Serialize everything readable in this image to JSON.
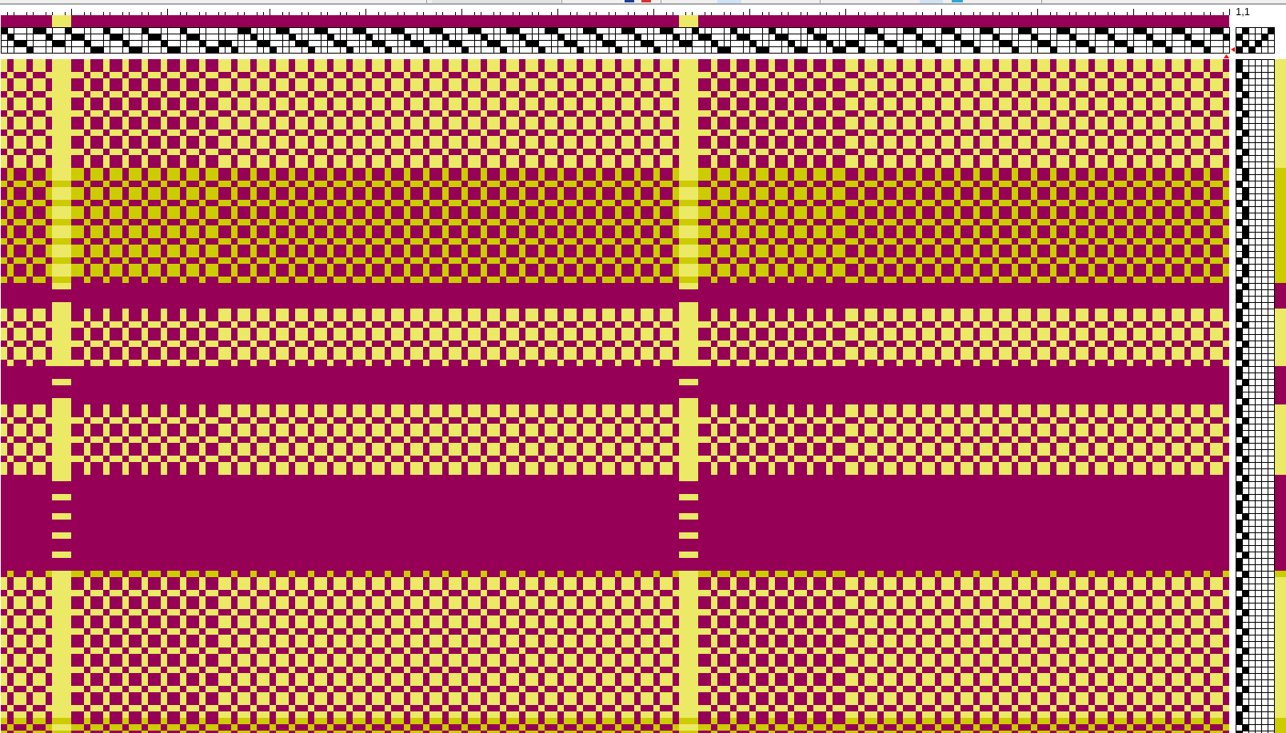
{
  "position_label": "1,1",
  "warp_stripes": [
    {
      "color": "#960056",
      "ends": [
        {
          "kind": "shaft4"
        },
        {
          "kind": "shaft3"
        },
        {
          "kind": "shaft2"
        },
        {
          "kind": "shaft2"
        },
        {
          "kind": "shaft1"
        },
        {
          "kind": "shaft4"
        },
        {
          "kind": "shaft4"
        },
        {
          "kind": "shaft3"
        }
      ]
    },
    {
      "color": "#ece966",
      "ends": [
        {
          "kind": "shaft2"
        },
        {
          "kind": "shaft2"
        },
        {
          "kind": "shaft4"
        }
      ]
    },
    {
      "color": "#960056",
      "ends": [
        {
          "kind": "shaft3"
        },
        {
          "kind": "shaft3"
        },
        {
          "kind": "shaft2"
        },
        {
          "kind": "shaft1"
        },
        {
          "kind": "shaft1"
        },
        {
          "kind": "shaft4"
        },
        {
          "kind": "shaft3"
        },
        {
          "kind": "shaft3"
        },
        {
          "kind": "shaft2"
        },
        {
          "kind": "shaft1"
        },
        {
          "kind": "shaft1"
        },
        {
          "kind": "shaft4"
        },
        {
          "kind": "shaft3"
        },
        {
          "kind": "shaft3"
        },
        {
          "kind": "shaft2"
        },
        {
          "kind": "shaft1"
        },
        {
          "kind": "shaft1"
        },
        {
          "kind": "shaft4"
        },
        {
          "kind": "shaft3"
        },
        {
          "kind": "shaft3"
        },
        {
          "kind": "shaft2"
        },
        {
          "kind": "shaft1"
        },
        {
          "kind": "shaft1"
        },
        {
          "kind": "shaft2"
        },
        {
          "kind": "shaft2"
        },
        {
          "kind": "shaft1"
        },
        {
          "kind": "shaft4"
        },
        {
          "kind": "shaft4"
        },
        {
          "kind": "shaft3"
        },
        {
          "kind": "shaft2"
        },
        {
          "kind": "shaft2"
        },
        {
          "kind": "shaft1"
        },
        {
          "kind": "shaft4"
        },
        {
          "kind": "shaft4"
        },
        {
          "kind": "shaft3"
        },
        {
          "kind": "shaft2"
        },
        {
          "kind": "shaft2"
        },
        {
          "kind": "shaft1"
        },
        {
          "kind": "shaft4"
        },
        {
          "kind": "shaft4"
        },
        {
          "kind": "shaft3"
        },
        {
          "kind": "shaft2"
        },
        {
          "kind": "shaft2"
        },
        {
          "kind": "shaft1"
        },
        {
          "kind": "shaft4"
        },
        {
          "kind": "shaft4"
        },
        {
          "kind": "shaft3"
        },
        {
          "kind": "shaft2"
        },
        {
          "kind": "shaft2"
        },
        {
          "kind": "shaft1"
        },
        {
          "kind": "shaft4"
        },
        {
          "kind": "shaft4"
        },
        {
          "kind": "shaft3"
        },
        {
          "kind": "shaft2"
        },
        {
          "kind": "shaft2"
        },
        {
          "kind": "shaft1"
        },
        {
          "kind": "shaft4"
        },
        {
          "kind": "shaft4"
        },
        {
          "kind": "shaft3"
        },
        {
          "kind": "shaft2"
        },
        {
          "kind": "shaft2"
        },
        {
          "kind": "shaft1"
        },
        {
          "kind": "shaft4"
        },
        {
          "kind": "shaft4"
        },
        {
          "kind": "shaft3"
        },
        {
          "kind": "shaft2"
        },
        {
          "kind": "shaft2"
        },
        {
          "kind": "shaft1"
        },
        {
          "kind": "shaft4"
        },
        {
          "kind": "shaft4"
        },
        {
          "kind": "shaft3"
        },
        {
          "kind": "shaft2"
        },
        {
          "kind": "shaft2"
        },
        {
          "kind": "shaft1"
        },
        {
          "kind": "shaft4"
        },
        {
          "kind": "shaft4"
        },
        {
          "kind": "shaft3"
        },
        {
          "kind": "shaft2"
        },
        {
          "kind": "shaft2"
        },
        {
          "kind": "shaft1"
        },
        {
          "kind": "shaft4"
        },
        {
          "kind": "shaft4"
        },
        {
          "kind": "shaft3"
        },
        {
          "kind": "shaft2"
        },
        {
          "kind": "shaft2"
        },
        {
          "kind": "shaft1"
        },
        {
          "kind": "shaft4"
        },
        {
          "kind": "shaft4"
        },
        {
          "kind": "shaft3"
        },
        {
          "kind": "shaft2"
        },
        {
          "kind": "shaft2"
        },
        {
          "kind": "shaft1"
        },
        {
          "kind": "shaft4"
        },
        {
          "kind": "shaft4"
        },
        {
          "kind": "shaft3"
        }
      ]
    },
    {
      "color": "#ece966",
      "ends": [
        {
          "kind": "shaft2"
        },
        {
          "kind": "shaft2"
        },
        {
          "kind": "shaft4"
        }
      ]
    },
    {
      "color": "#960056",
      "ends": [
        {
          "kind": "shaft3"
        },
        {
          "kind": "shaft3"
        },
        {
          "kind": "shaft2"
        },
        {
          "kind": "shaft1"
        },
        {
          "kind": "shaft1"
        },
        {
          "kind": "shaft4"
        },
        {
          "kind": "shaft3"
        },
        {
          "kind": "shaft3"
        },
        {
          "kind": "shaft2"
        },
        {
          "kind": "shaft1"
        },
        {
          "kind": "shaft1"
        },
        {
          "kind": "shaft4"
        },
        {
          "kind": "shaft3"
        },
        {
          "kind": "shaft3"
        },
        {
          "kind": "shaft2"
        },
        {
          "kind": "shaft1"
        },
        {
          "kind": "shaft1"
        },
        {
          "kind": "shaft4"
        },
        {
          "kind": "shaft3"
        },
        {
          "kind": "shaft3"
        },
        {
          "kind": "shaft2"
        },
        {
          "kind": "shaft1"
        },
        {
          "kind": "shaft1"
        },
        {
          "kind": "shaft2"
        },
        {
          "kind": "shaft2"
        },
        {
          "kind": "shaft1"
        },
        {
          "kind": "shaft4"
        },
        {
          "kind": "shaft4"
        },
        {
          "kind": "shaft3"
        },
        {
          "kind": "shaft2"
        },
        {
          "kind": "shaft2"
        },
        {
          "kind": "shaft1"
        },
        {
          "kind": "shaft4"
        },
        {
          "kind": "shaft4"
        },
        {
          "kind": "shaft3"
        },
        {
          "kind": "shaft2"
        },
        {
          "kind": "shaft2"
        },
        {
          "kind": "shaft1"
        },
        {
          "kind": "shaft4"
        },
        {
          "kind": "shaft4"
        },
        {
          "kind": "shaft3"
        },
        {
          "kind": "shaft2"
        },
        {
          "kind": "shaft2"
        },
        {
          "kind": "shaft1"
        },
        {
          "kind": "shaft4"
        },
        {
          "kind": "shaft4"
        },
        {
          "kind": "shaft3"
        },
        {
          "kind": "shaft2"
        },
        {
          "kind": "shaft2"
        },
        {
          "kind": "shaft1"
        },
        {
          "kind": "shaft4"
        },
        {
          "kind": "shaft4"
        },
        {
          "kind": "shaft3"
        },
        {
          "kind": "shaft2"
        },
        {
          "kind": "shaft2"
        },
        {
          "kind": "shaft1"
        },
        {
          "kind": "shaft4"
        },
        {
          "kind": "shaft4"
        },
        {
          "kind": "shaft3"
        },
        {
          "kind": "shaft2"
        },
        {
          "kind": "shaft2"
        },
        {
          "kind": "shaft1"
        },
        {
          "kind": "shaft4"
        },
        {
          "kind": "shaft4"
        },
        {
          "kind": "shaft3"
        },
        {
          "kind": "shaft2"
        },
        {
          "kind": "shaft2"
        },
        {
          "kind": "shaft1"
        },
        {
          "kind": "shaft4"
        },
        {
          "kind": "shaft4"
        },
        {
          "kind": "shaft3"
        },
        {
          "kind": "shaft2"
        },
        {
          "kind": "shaft2"
        },
        {
          "kind": "shaft1"
        },
        {
          "kind": "shaft4"
        },
        {
          "kind": "shaft4"
        },
        {
          "kind": "shaft3"
        },
        {
          "kind": "shaft2"
        },
        {
          "kind": "shaft2"
        },
        {
          "kind": "shaft1"
        },
        {
          "kind": "shaft4"
        },
        {
          "kind": "shaft4"
        },
        {
          "kind": "shaft3"
        }
      ]
    }
  ],
  "tie_up": {
    "rows": [
      [
        false,
        true,
        false,
        false,
        false,
        true
      ],
      [
        true,
        false,
        false,
        false,
        true,
        false
      ],
      [
        false,
        true,
        false,
        true,
        false,
        false
      ],
      [
        true,
        false,
        true,
        false,
        false,
        false
      ]
    ]
  },
  "weft_stripes": [
    {
      "color": "#ece966",
      "picks": [
        {
          "kind": "treadle1"
        },
        {
          "kind": "treadle1"
        },
        {
          "kind": "treadle2"
        },
        {
          "kind": "treadle1"
        },
        {
          "kind": "treadle1"
        },
        {
          "kind": "treadle2"
        },
        {
          "kind": "treadle1"
        },
        {
          "kind": "treadle1"
        },
        {
          "kind": "treadle2"
        },
        {
          "kind": "treadle1"
        },
        {
          "kind": "treadle1"
        },
        {
          "kind": "treadle2"
        },
        {
          "kind": "treadle1"
        },
        {
          "kind": "treadle1"
        },
        {
          "kind": "treadle2"
        },
        {
          "kind": "treadle1"
        },
        {
          "kind": "treadle1"
        }
      ]
    },
    {
      "color": "#cccc00",
      "picks": [
        {
          "kind": "treadle2"
        },
        {
          "kind": "treadle2"
        },
        {
          "kind": "treadle1"
        },
        {
          "kind": "treadle2"
        },
        {
          "kind": "treadle2"
        },
        {
          "kind": "treadle1"
        },
        {
          "kind": "treadle2"
        },
        {
          "kind": "treadle2"
        },
        {
          "kind": "treadle1"
        },
        {
          "kind": "treadle2"
        },
        {
          "kind": "treadle2"
        },
        {
          "kind": "treadle1"
        },
        {
          "kind": "treadle2"
        },
        {
          "kind": "treadle2"
        },
        {
          "kind": "treadle1"
        },
        {
          "kind": "treadle2"
        },
        {
          "kind": "treadle2"
        },
        {
          "kind": "treadle1"
        }
      ]
    },
    {
      "color": "#960056",
      "picks": [
        {
          "kind": "treadle2"
        },
        {
          "kind": "treadle1"
        },
        {
          "kind": "treadle1"
        },
        {
          "kind": "treadle2"
        }
      ]
    },
    {
      "color": "#ece966",
      "picks": [
        {
          "kind": "treadle1"
        },
        {
          "kind": "treadle1"
        },
        {
          "kind": "treadle2"
        },
        {
          "kind": "treadle1"
        },
        {
          "kind": "treadle1"
        },
        {
          "kind": "treadle2"
        },
        {
          "kind": "treadle1"
        },
        {
          "kind": "treadle1"
        },
        {
          "kind": "treadle2"
        }
      ]
    },
    {
      "color": "#960056",
      "picks": [
        {
          "kind": "treadle1"
        },
        {
          "kind": "treadle1"
        },
        {
          "kind": "treadle2"
        },
        {
          "kind": "treadle1"
        },
        {
          "kind": "treadle1"
        },
        {
          "kind": "treadle2"
        }
      ]
    },
    {
      "color": "#ece966",
      "picks": [
        {
          "kind": "treadle1"
        },
        {
          "kind": "treadle1"
        },
        {
          "kind": "treadle2"
        },
        {
          "kind": "treadle1"
        },
        {
          "kind": "treadle1"
        },
        {
          "kind": "treadle2"
        },
        {
          "kind": "treadle1"
        },
        {
          "kind": "treadle1"
        },
        {
          "kind": "treadle2"
        },
        {
          "kind": "treadle1"
        },
        {
          "kind": "treadle1"
        }
      ]
    },
    {
      "color": "#960056",
      "picks": [
        {
          "kind": "treadle2"
        },
        {
          "kind": "treadle1"
        },
        {
          "kind": "treadle1"
        },
        {
          "kind": "treadle2"
        },
        {
          "kind": "treadle1"
        },
        {
          "kind": "treadle1"
        },
        {
          "kind": "treadle2"
        },
        {
          "kind": "treadle1"
        },
        {
          "kind": "treadle1"
        },
        {
          "kind": "treadle2"
        },
        {
          "kind": "treadle1"
        },
        {
          "kind": "treadle1"
        },
        {
          "kind": "treadle2"
        },
        {
          "kind": "treadle1"
        },
        {
          "kind": "treadle1"
        }
      ]
    },
    {
      "color": "#cccc00",
      "picks": [
        {
          "kind": "treadle2"
        }
      ]
    },
    {
      "color": "#ece966",
      "picks": [
        {
          "kind": "treadle1"
        },
        {
          "kind": "treadle1"
        },
        {
          "kind": "treadle2"
        },
        {
          "kind": "treadle1"
        },
        {
          "kind": "treadle1"
        },
        {
          "kind": "treadle2"
        },
        {
          "kind": "treadle1"
        },
        {
          "kind": "treadle1"
        },
        {
          "kind": "treadle2"
        },
        {
          "kind": "treadle1"
        },
        {
          "kind": "treadle1"
        },
        {
          "kind": "treadle2"
        },
        {
          "kind": "treadle1"
        },
        {
          "kind": "treadle1"
        },
        {
          "kind": "treadle2"
        },
        {
          "kind": "treadle1"
        },
        {
          "kind": "treadle1"
        },
        {
          "kind": "treadle2"
        },
        {
          "kind": "treadle1"
        },
        {
          "kind": "treadle1"
        },
        {
          "kind": "treadle2"
        },
        {
          "kind": "treadle1"
        }
      ]
    },
    {
      "color": "#cccc00",
      "picks": [
        {
          "kind": "treadle1"
        },
        {
          "kind": "treadle2"
        },
        {
          "kind": "treadle1"
        }
      ]
    }
  ]
}
